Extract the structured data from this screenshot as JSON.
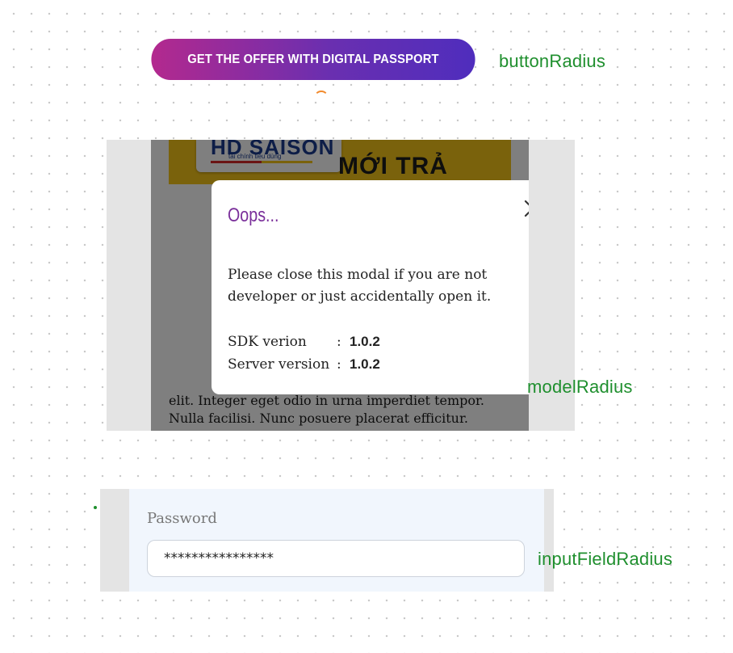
{
  "button": {
    "label": "GET THE OFFER WITH DIGITAL PASSPORT"
  },
  "annotations": {
    "button_radius": "buttonRadius",
    "modal_radius": "modelRadius",
    "input_field_radius": "inputFieldRadius"
  },
  "background_page": {
    "logo_text": "HD SAISON",
    "logo_tagline": "tài chính tiêu dùng",
    "banner_text": "MỚI TRẢ",
    "body_text": "elit. Integer eget odio in urna imperdiet tempor. Nulla facilisi. Nunc posuere placerat efficitur."
  },
  "modal": {
    "title": "Oops...",
    "message": "Please close this modal if you are not developer or just accidentally open it.",
    "info": [
      {
        "label": "SDK verion",
        "separator": ":",
        "value": "1.0.2"
      },
      {
        "label": "Server version",
        "separator": ":",
        "value": "1.0.2"
      }
    ],
    "close_icon": "close-icon"
  },
  "password_field": {
    "label": "Password",
    "value": "****************"
  },
  "colors": {
    "button_gradient_start": "#b3298e",
    "button_gradient_end": "#4f2dbd",
    "modal_title": "#7a2f9a",
    "annotation_text": "#1f8f2e",
    "banner_yellow": "#f5c518"
  }
}
